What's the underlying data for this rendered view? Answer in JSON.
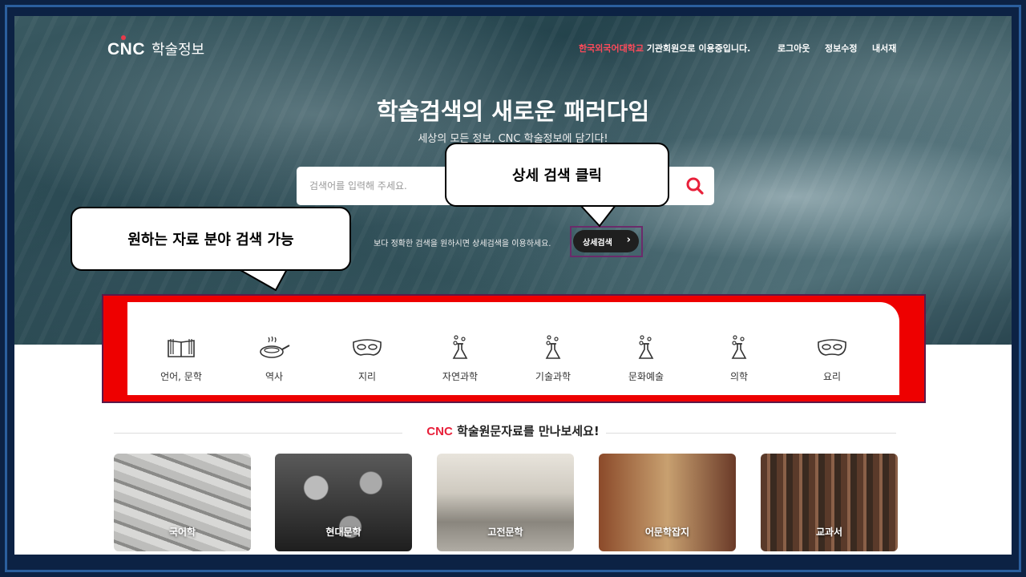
{
  "header": {
    "logo_mark": "CNC",
    "logo_text": "학술정보",
    "member_org": "한국외국어대학교",
    "member_suffix": " 기관회원으로 이용중입니다.",
    "links": [
      "로그아웃",
      "정보수정",
      "내서재"
    ]
  },
  "hero": {
    "title": "학술검색의 새로운 패러다임",
    "subtitle": "세상의 모든 정보, CNC 학술정보에 담기다!"
  },
  "search": {
    "placeholder": "검색어를 입력해 주세요.",
    "value": "",
    "button_icon": "search-icon",
    "advanced_hint": "보다 정확한 검색을 원하시면 상세검색을 이용하세요.",
    "advanced_label": "상세검색"
  },
  "callouts": {
    "advanced": "상세 검색 클릭",
    "category": "원하는 자료 분야 검색 가능"
  },
  "categories": [
    {
      "label": "언어, 문학",
      "icon": "book-icon"
    },
    {
      "label": "역사",
      "icon": "pan-icon"
    },
    {
      "label": "지리",
      "icon": "mask-icon"
    },
    {
      "label": "자연과학",
      "icon": "flask-icon"
    },
    {
      "label": "기술과학",
      "icon": "flask-icon"
    },
    {
      "label": "문화예술",
      "icon": "flask-icon"
    },
    {
      "label": "의학",
      "icon": "flask-icon"
    },
    {
      "label": "요리",
      "icon": "mask-icon"
    }
  ],
  "section": {
    "brand": "CNC",
    "title": " 학술원문자료를 만나보세요!"
  },
  "cards": [
    {
      "label": "국어학",
      "color": "#9a9a98"
    },
    {
      "label": "현대문학",
      "color": "#3a3a3a"
    },
    {
      "label": "고전문학",
      "color": "#b8b4ac"
    },
    {
      "label": "어문학잡지",
      "color": "#7a4a30"
    },
    {
      "label": "교과서",
      "color": "#6a5040"
    }
  ],
  "colors": {
    "accent": "#e8203a",
    "highlight": "#ee0000",
    "frame": "#0c2244"
  }
}
